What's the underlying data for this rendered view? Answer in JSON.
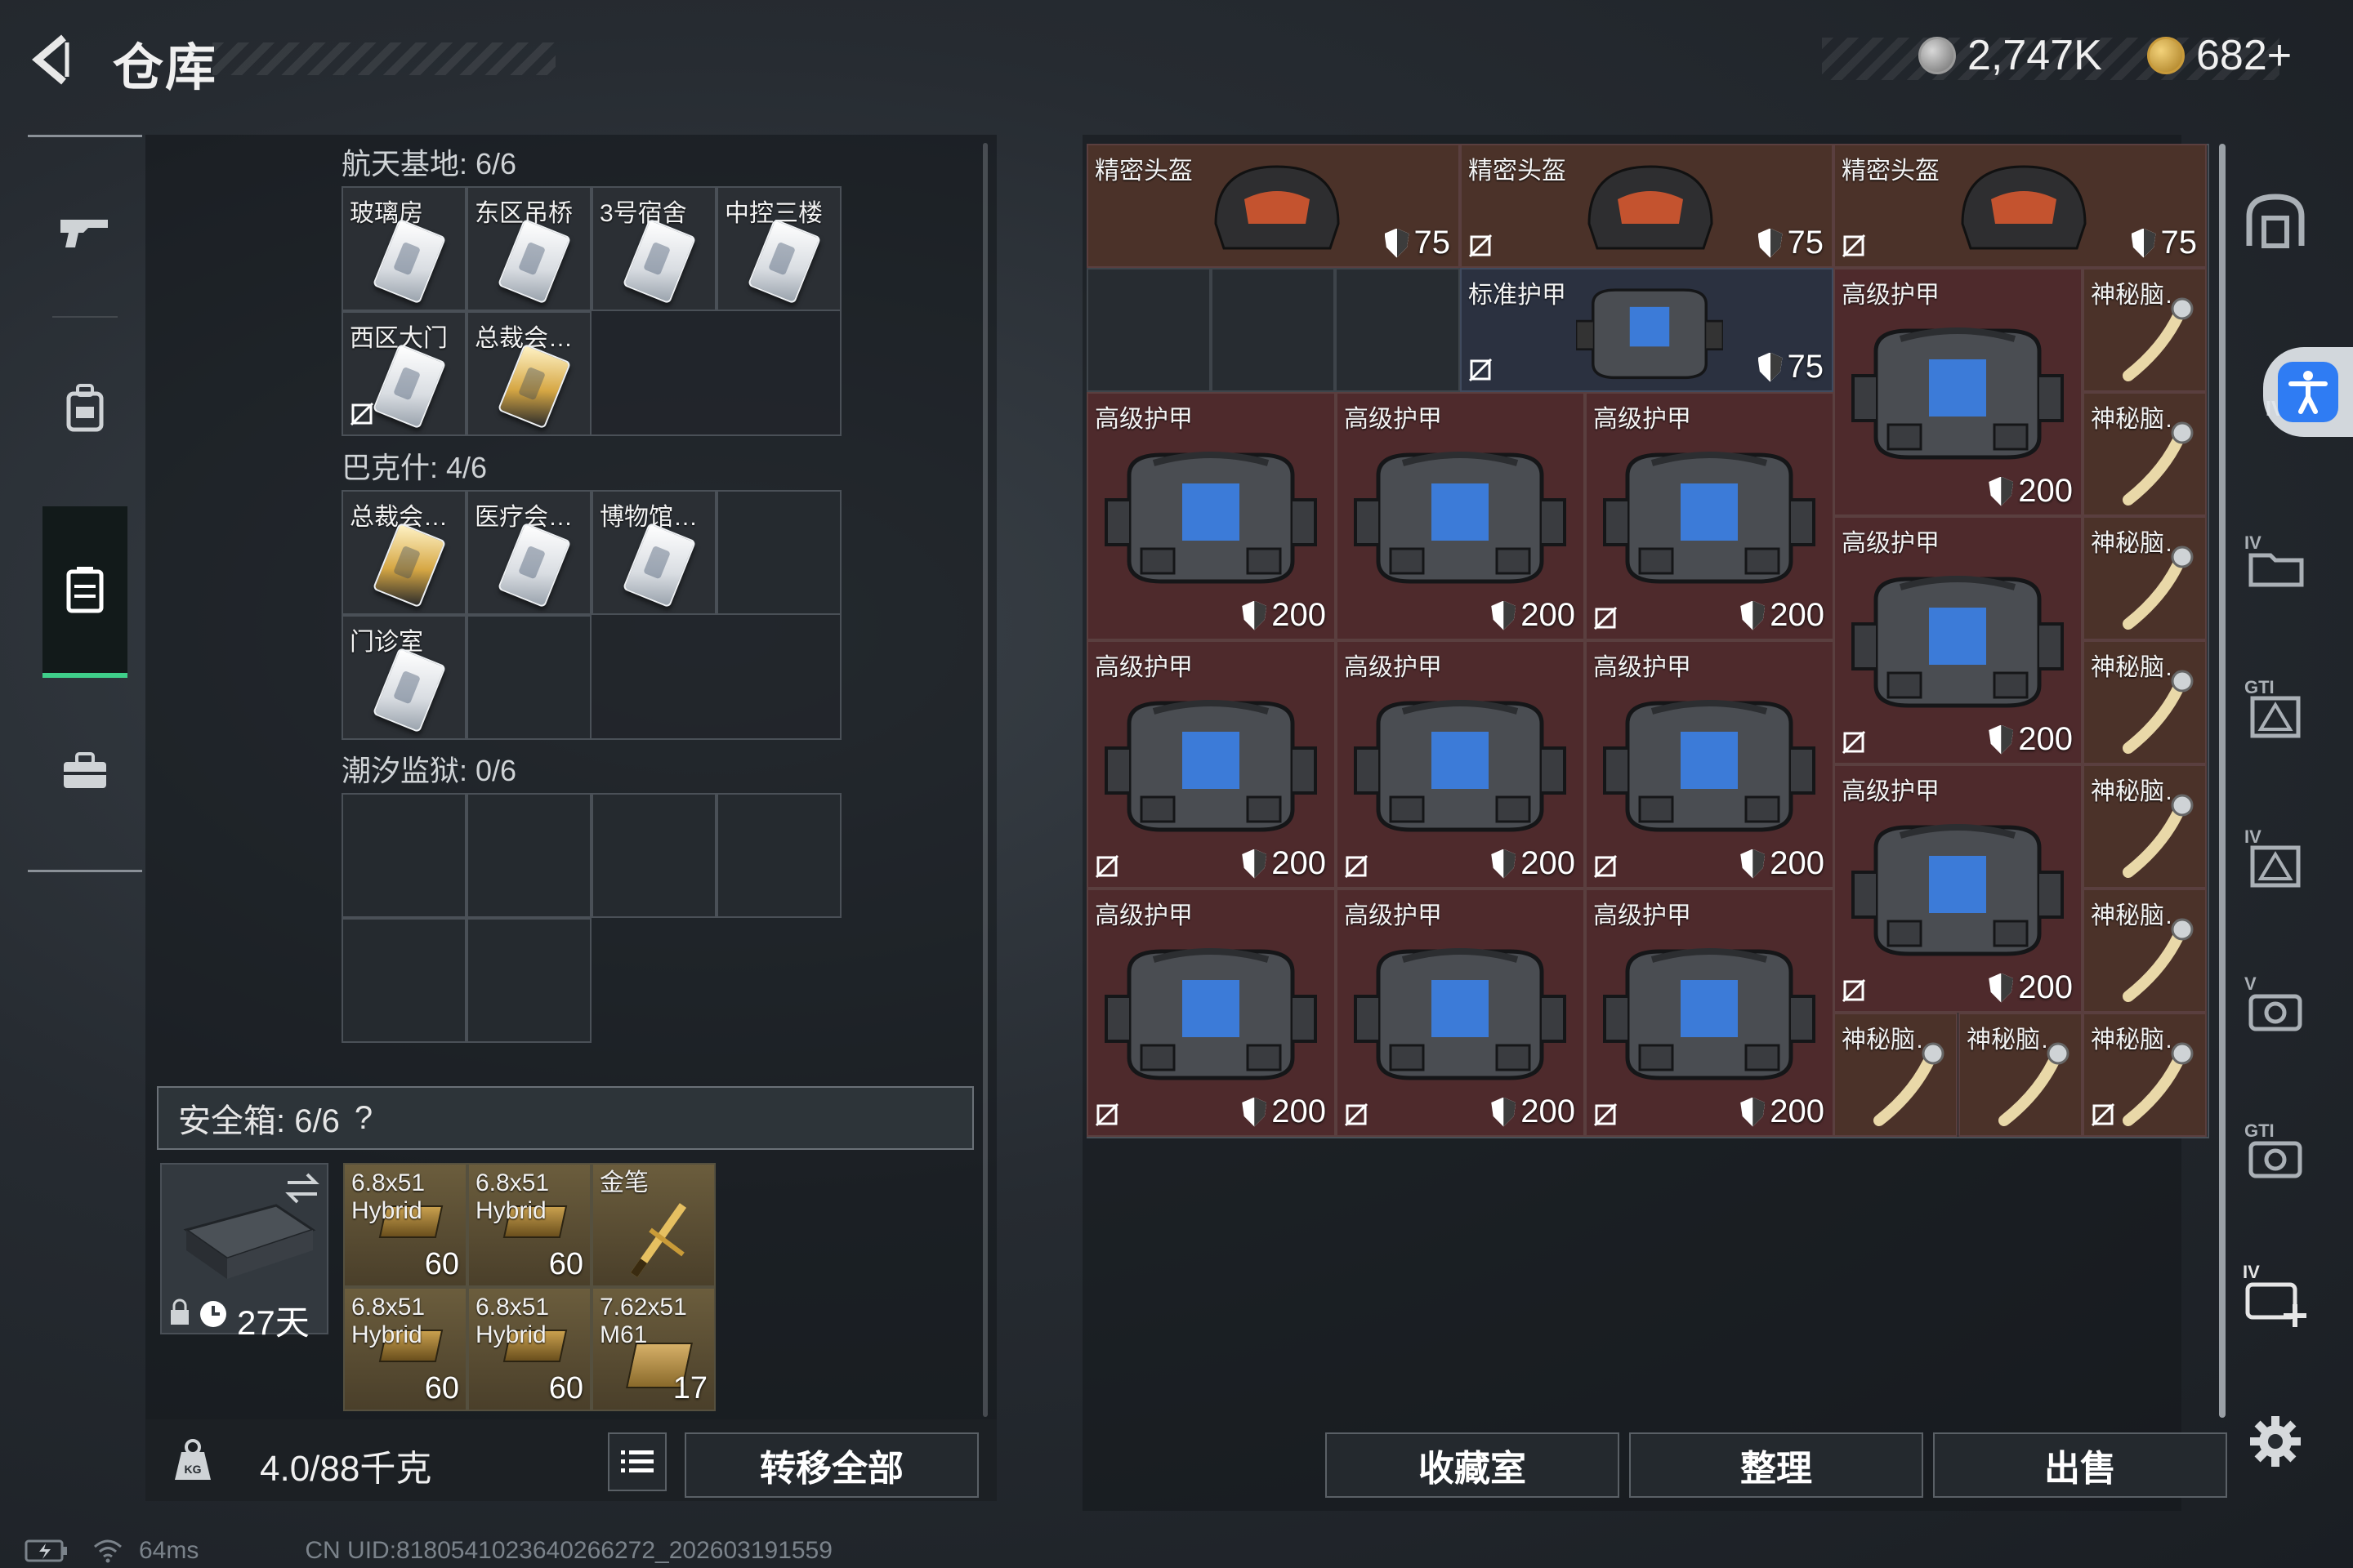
{
  "header": {
    "title": "仓库",
    "currency_silver": "2,747K",
    "currency_gold": "682+"
  },
  "storage": {
    "sections": [
      {
        "title": "航天基地: 6/6",
        "items": [
          {
            "name": "玻璃房",
            "card": "white"
          },
          {
            "name": "东区吊桥",
            "card": "white"
          },
          {
            "name": "3号宿舍",
            "card": "white"
          },
          {
            "name": "中控三楼",
            "card": "white"
          },
          {
            "name": "西区大门",
            "card": "white",
            "no_insure": true
          },
          {
            "name": "总裁会…",
            "card": "gold"
          }
        ]
      },
      {
        "title": "巴克什: 4/6",
        "items": [
          {
            "name": "总裁会…",
            "card": "gold"
          },
          {
            "name": "医疗会…",
            "card": "white"
          },
          {
            "name": "博物馆…",
            "card": "white"
          },
          {
            "name": "门诊室",
            "card": "white"
          }
        ]
      },
      {
        "title": "潮汐监狱: 0/6",
        "items": []
      }
    ]
  },
  "safe_box": {
    "label": "安全箱: 6/6",
    "help": "?",
    "timer": "27天",
    "ammo": [
      {
        "name": "6.8x51\nHybrid",
        "count": "60"
      },
      {
        "name": "6.8x51\nHybrid",
        "count": "60"
      },
      {
        "name": "金笔",
        "count": ""
      },
      {
        "name": "6.8x51\nHybrid",
        "count": "60"
      },
      {
        "name": "6.8x51\nHybrid",
        "count": "60"
      },
      {
        "name": "7.62x51\nM61",
        "count": "17"
      }
    ]
  },
  "bottom_left": {
    "weight": "4.0/88千克",
    "transfer_all": "转移全部"
  },
  "inventory": {
    "helmets": [
      {
        "name": "精密头盔",
        "durability": "75"
      },
      {
        "name": "精密头盔",
        "durability": "75"
      },
      {
        "name": "精密头盔",
        "durability": "75"
      }
    ],
    "standard_armor": {
      "name": "标准护甲",
      "durability": "75"
    },
    "armor_name": "高级护甲",
    "armor_durability": "200",
    "brain_name": "神秘脑…"
  },
  "actions": {
    "collection": "收藏室",
    "organize": "整理",
    "sell": "出售"
  },
  "right_nav": [
    "IV",
    "IV",
    "GTI",
    "IV",
    "V",
    "GTI",
    "IV"
  ],
  "footer": {
    "ping": "64ms",
    "uid": "CN UID:8180541023640266272_202603191559"
  }
}
